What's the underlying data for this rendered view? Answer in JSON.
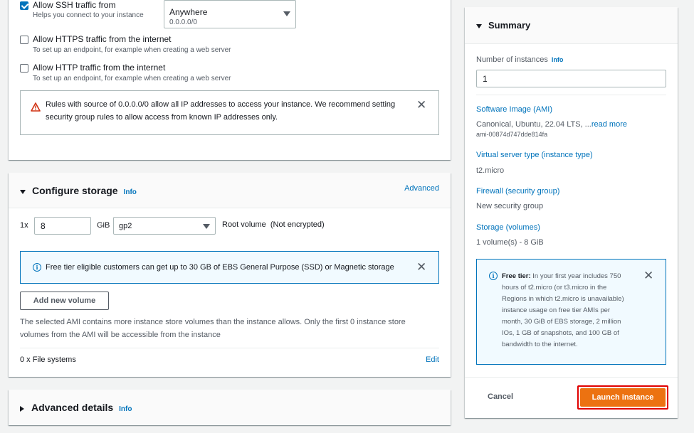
{
  "network": {
    "ssh": {
      "label": "Allow SSH traffic from",
      "description": "Helps you connect to your instance",
      "checked": true,
      "source_select": {
        "value": "Anywhere",
        "sub": "0.0.0.0/0"
      }
    },
    "https": {
      "label": "Allow HTTPS traffic from the internet",
      "description": "To set up an endpoint, for example when creating a web server",
      "checked": false
    },
    "http": {
      "label": "Allow HTTP traffic from the internet",
      "description": "To set up an endpoint, for example when creating a web server",
      "checked": false
    },
    "warning": {
      "icon": "warning-triangle-icon",
      "text": "Rules with source of 0.0.0.0/0 allow all IP addresses to access your instance. We recommend setting security group rules to allow access from known IP addresses only."
    }
  },
  "storage": {
    "title": "Configure storage",
    "info": "Info",
    "advanced": "Advanced",
    "multiplier": "1x",
    "size_value": "8",
    "unit": "GiB",
    "volume_type": "gp2",
    "root_label": "Root volume",
    "encryption": "(Not encrypted)",
    "free_tier_alert": "Free tier eligible customers can get up to 30 GB of EBS General Purpose (SSD) or Magnetic storage",
    "add_volume": "Add new volume",
    "note": "The selected AMI contains more instance store volumes than the instance allows. Only the first 0 instance store volumes from the AMI will be accessible from the instance",
    "file_systems": "0 x File systems",
    "edit": "Edit"
  },
  "advanced_details": {
    "title": "Advanced details",
    "info": "Info"
  },
  "summary": {
    "title": "Summary",
    "instances_label": "Number of instances",
    "instances_info": "Info",
    "instances_value": "1",
    "ami_label": "Software Image (AMI)",
    "ami_value": "Canonical, Ubuntu, 22.04 LTS, ...",
    "ami_read_more": "read more",
    "ami_id": "ami-00874d747dde814fa",
    "type_label": "Virtual server type (instance type)",
    "type_value": "t2.micro",
    "firewall_label": "Firewall (security group)",
    "firewall_value": "New security group",
    "storage_label": "Storage (volumes)",
    "storage_value": "1 volume(s) - 8 GiB",
    "free_tier_bold": "Free tier:",
    "free_tier_text": " In your first year includes 750 hours of t2.micro (or t3.micro in the Regions in which t2.micro is unavailable) instance usage on free tier AMIs per month, 30 GiB of EBS storage, 2 million IOs, 1 GB of snapshots, and 100 GB of bandwidth to the internet.",
    "cancel": "Cancel",
    "launch": "Launch instance"
  },
  "colors": {
    "primary_button": "#ec7211",
    "highlight_border": "#e00000",
    "link": "#0073bb",
    "info_alert_bg": "#f1faff",
    "warning_icon": "#d13212"
  }
}
